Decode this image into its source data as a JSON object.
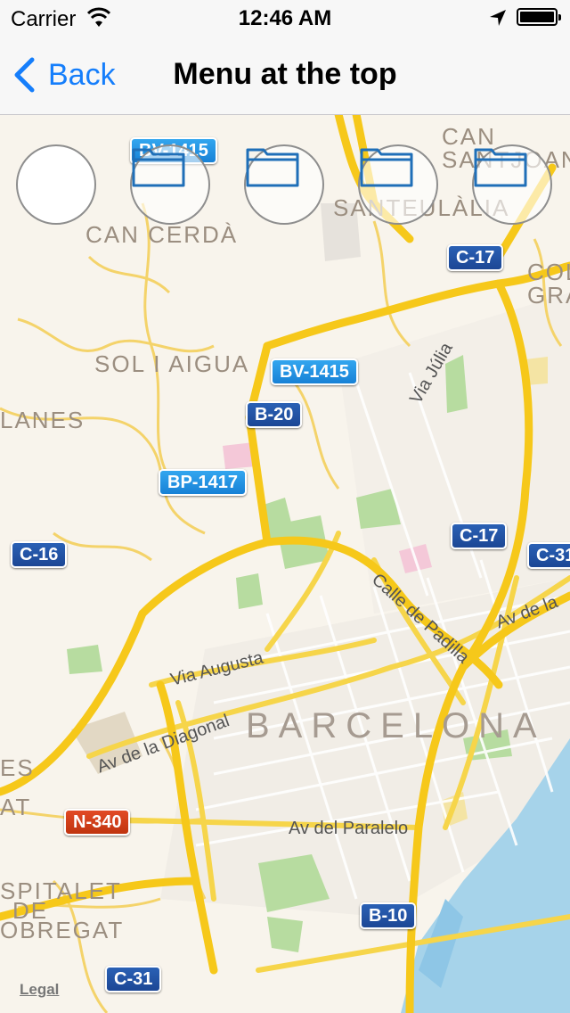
{
  "status_bar": {
    "carrier": "Carrier",
    "time": "12:46 AM"
  },
  "nav": {
    "back_label": "Back",
    "title": "Menu at the top"
  },
  "menu_buttons": [
    {
      "icon": "empty"
    },
    {
      "icon": "folder-icon"
    },
    {
      "icon": "folder-icon"
    },
    {
      "icon": "folder-icon"
    },
    {
      "icon": "folder-icon"
    }
  ],
  "map": {
    "places": {
      "can_santjoan": "CAN SANTJOAN",
      "can_cerda": "CAN CERDÀ",
      "santeulalia": "SANTEULÀLIA",
      "sol_i_aigua": "SOL I AIGUA",
      "lanes": "LANES",
      "col_gra": "COL GRA",
      "barcelona": "BARCELONA",
      "spitalet": "SPITALET",
      "de": "DE",
      "obregat": "OBREGAT",
      "es": "ES",
      "at": "AT"
    },
    "streets": {
      "via_julia": "Via Júlia",
      "calle_padilla": "Calle de Padilla",
      "av_de_la": "Av de la",
      "via_augusta": "Via Augusta",
      "av_diagonal": "Av de la Diagonal",
      "av_paralelo": "Av del Paralelo"
    },
    "shields": {
      "bv1415_a": "BV-1415",
      "c17_a": "C-17",
      "bv1415_b": "BV-1415",
      "b20": "B-20",
      "bp1417": "BP-1417",
      "c16": "C-16",
      "c17_b": "C-17",
      "c31_a": "C-31",
      "n340": "N-340",
      "b10": "B-10",
      "c31_b": "C-31"
    },
    "legal": "Legal",
    "colors": {
      "land": "#f8f4ec",
      "park": "#b7dca0",
      "water": "#a6d3ea",
      "highway": "#f6c81a"
    }
  }
}
